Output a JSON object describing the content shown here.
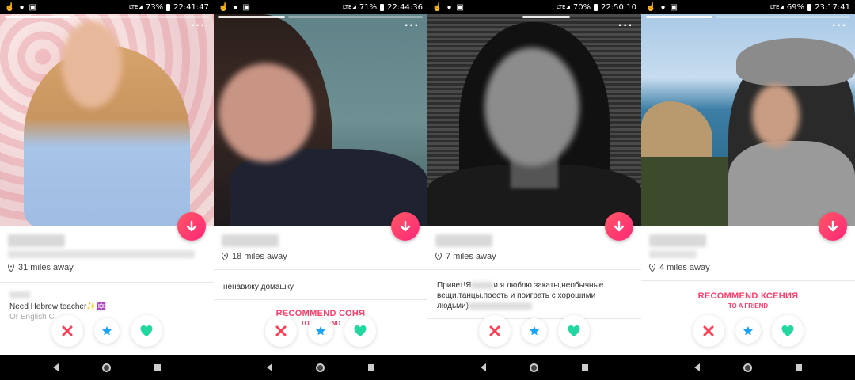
{
  "panels": [
    {
      "status": {
        "signal": "LTE",
        "battery": "73%",
        "time": "22:41:47"
      },
      "distance": "31 miles away",
      "bio_line1": "Need Hebrew teacher✨🔯",
      "bio_line2": "Or English C",
      "recommend_title": "",
      "recommend_sub": ""
    },
    {
      "status": {
        "signal": "LTE",
        "battery": "71%",
        "time": "22:44:36"
      },
      "distance": "18 miles away",
      "bio_line1": "ненавижу домашку",
      "bio_line2": "",
      "recommend_title": "RECOMMEND СОНЯ",
      "recommend_sub": "TO A FRIEND"
    },
    {
      "status": {
        "signal": "LTE",
        "battery": "70%",
        "time": "22:50:10"
      },
      "distance": "7 miles away",
      "bio_line1": "Привет!Я",
      "bio_line1b": "и я люблю закаты,необычные",
      "bio_line2": "вещи,танцы,поесть и поиграть с хорошими",
      "bio_line3": "людьми)",
      "recommend_title": "",
      "recommend_sub": ""
    },
    {
      "status": {
        "signal": "LTE",
        "battery": "69%",
        "time": "23:17:41"
      },
      "distance": "4 miles away",
      "bio_line1": "",
      "bio_line2": "",
      "recommend_title": "RECOMMEND КСЕНИЯ",
      "recommend_sub": "TO A FRIEND"
    }
  ],
  "colors": {
    "brand_pink": "#fd267a",
    "nope_red": "#fd3e54",
    "super_blue": "#1ca4f4",
    "like_green": "#22d8a0"
  },
  "icons": [
    "hand-icon",
    "person-icon",
    "image-icon",
    "signal-icon",
    "battery-icon",
    "more-icon",
    "location-pin-icon",
    "down-arrow-icon",
    "nope-x-icon",
    "super-like-star-icon",
    "like-heart-icon",
    "back-icon",
    "home-icon",
    "recents-icon"
  ]
}
